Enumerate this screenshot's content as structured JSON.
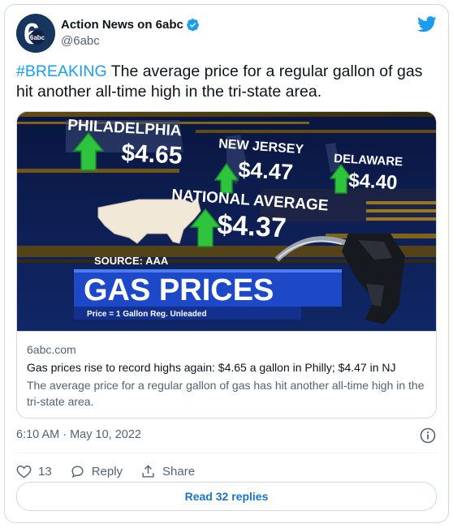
{
  "author": {
    "name": "Action News on 6abc",
    "handle": "@6abc",
    "avatar_text": "6abc"
  },
  "tweet": {
    "hashtag": "#BREAKING",
    "body": " The average price for a regular gallon of gas hit another all-time high in the tri-state area."
  },
  "card": {
    "image": {
      "philadelphia_label": "PHILADELPHIA",
      "philadelphia_price": "$4.65",
      "new_jersey_label": "NEW JERSEY",
      "new_jersey_price": "$4.47",
      "delaware_label": "DELAWARE",
      "delaware_price": "$4.40",
      "national_label": "NATIONAL AVERAGE",
      "national_price": "$4.37",
      "source": "SOURCE: AAA",
      "headline": "GAS PRICES",
      "footnote": "Price = 1 Gallon Reg. Unleaded"
    },
    "domain": "6abc.com",
    "title": "Gas prices rise to record highs again: $4.65 a gallon in Philly; $4.47 in NJ",
    "description": "The average price for a regular gallon of gas has hit another all-time high in the tri-state area."
  },
  "meta": {
    "timestamp": "6:10 AM · May 10, 2022"
  },
  "actions": {
    "like_count": "13",
    "reply_label": "Reply",
    "share_label": "Share",
    "read_replies_label": "Read 32 replies"
  },
  "colors": {
    "accent": "#1d9bf0",
    "verified": "#1d9bf0",
    "arrow_green": "#2ec43e",
    "banner_blue": "#1d48c8"
  }
}
